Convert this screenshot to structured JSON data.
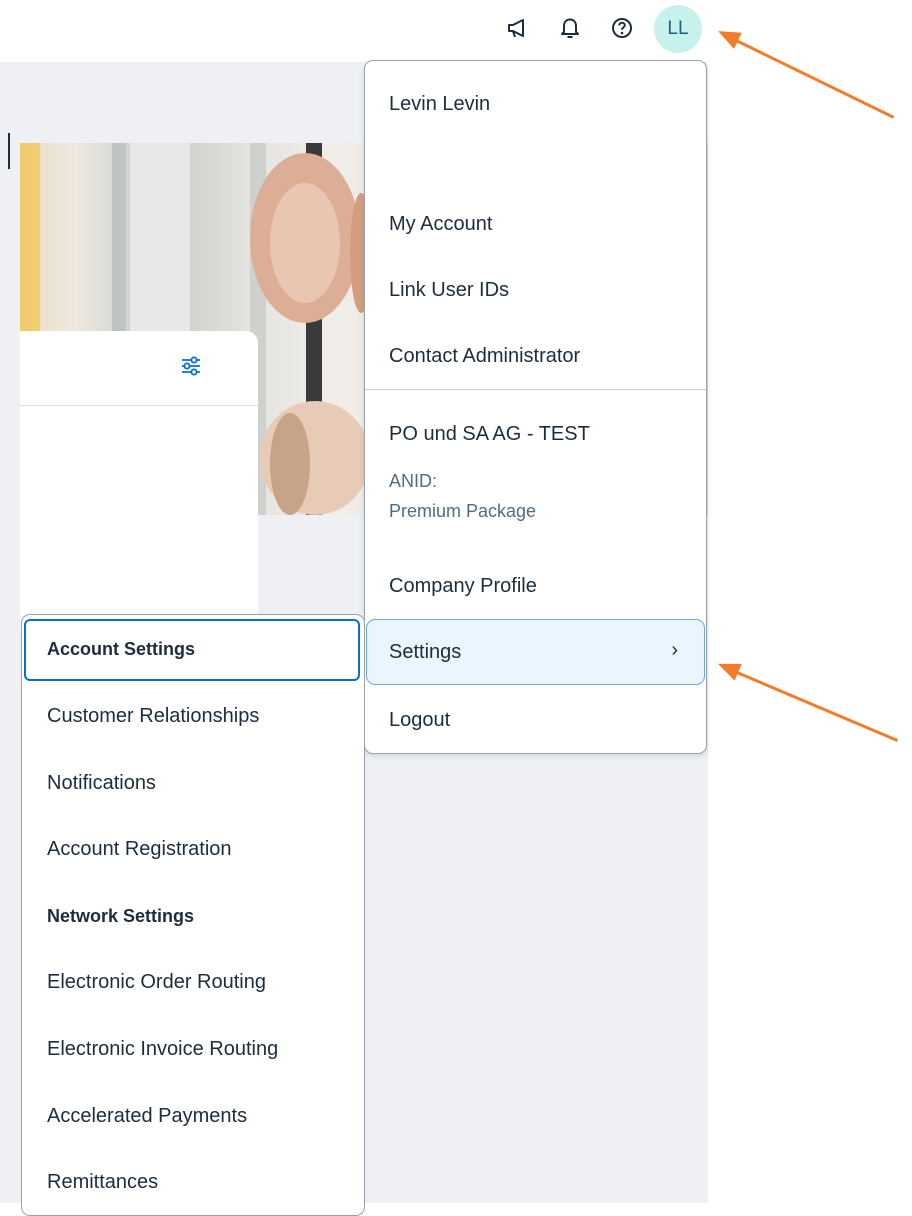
{
  "shellbar": {
    "icons": [
      "megaphone-icon",
      "bell-icon",
      "help-icon"
    ],
    "avatar_initials": "LL",
    "avatar_color": "#c7f1ec"
  },
  "user_menu": {
    "user_name": "Levin Levin",
    "my_account": "My Account",
    "link_user_ids": "Link User IDs",
    "contact_admin": "Contact Administrator",
    "company_name": "PO und SA AG - TEST",
    "anid_label": "ANID:",
    "package": "Premium Package",
    "company_profile": "Company Profile",
    "settings": "Settings",
    "settings_chevron": "›",
    "logout": "Logout"
  },
  "settings_menu": {
    "items": [
      "Account Settings",
      "Customer Relationships",
      "Notifications",
      "Account Registration",
      "Network Settings",
      "Electronic Order Routing",
      "Electronic Invoice Routing",
      "Accelerated Payments",
      "Remittances"
    ]
  },
  "colors": {
    "accent": "#0a6ed1",
    "annotation_arrow": "#ef7d2a",
    "settings_highlight": "#eaf5fd"
  }
}
